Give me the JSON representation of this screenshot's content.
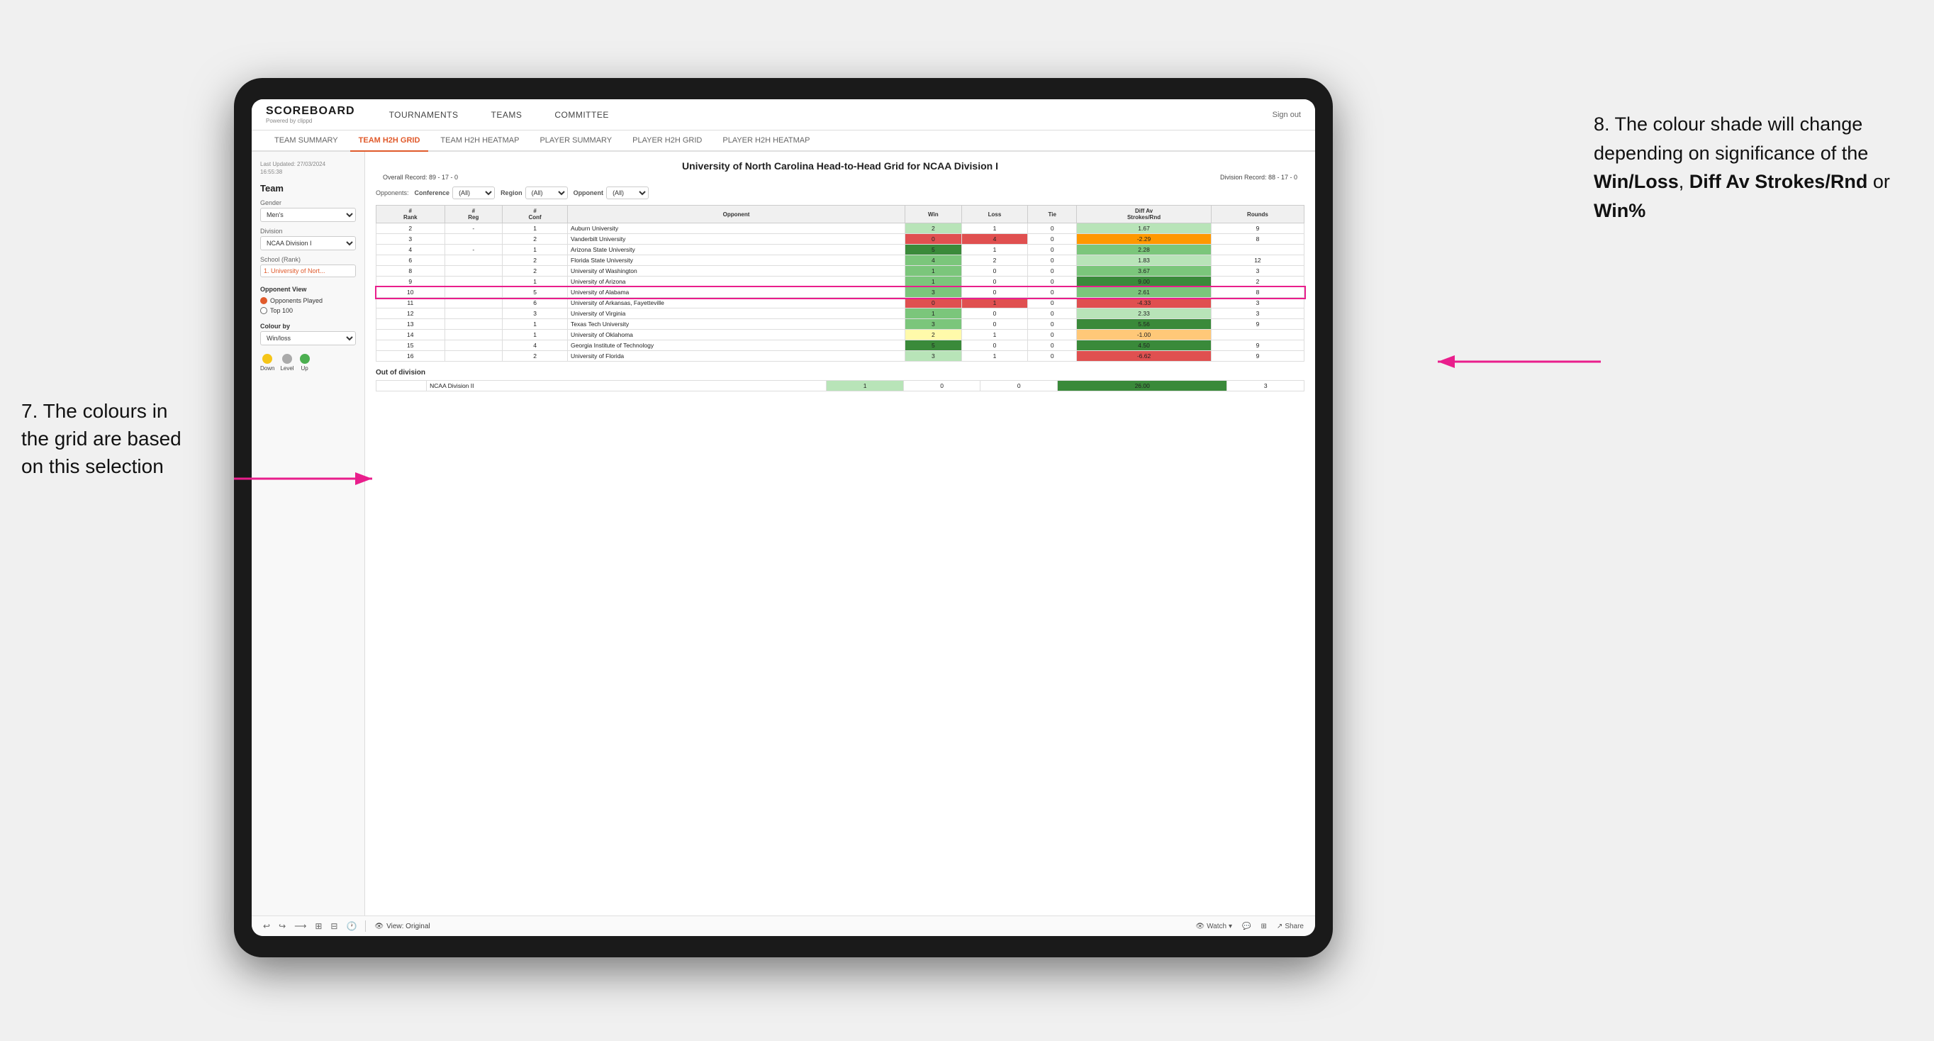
{
  "annotations": {
    "left_title": "8. The colour shade will change depending on significance of the",
    "left_bold1": "Win/Loss",
    "left_sep1": ", ",
    "left_bold2": "Diff Av Strokes/Rnd",
    "left_sep2": " or ",
    "left_bold3": "Win%",
    "annotation7_line1": "7. The colours in",
    "annotation7_line2": "the grid are based",
    "annotation7_line3": "on this selection"
  },
  "nav": {
    "logo": "SCOREBOARD",
    "logo_sub": "Powered by clippd",
    "items": [
      "TOURNAMENTS",
      "TEAMS",
      "COMMITTEE"
    ],
    "sign_out": "Sign out"
  },
  "sub_nav": {
    "items": [
      "TEAM SUMMARY",
      "TEAM H2H GRID",
      "TEAM H2H HEATMAP",
      "PLAYER SUMMARY",
      "PLAYER H2H GRID",
      "PLAYER H2H HEATMAP"
    ],
    "active": "TEAM H2H GRID"
  },
  "sidebar": {
    "last_updated_label": "Last Updated: 27/03/2024",
    "last_updated_time": "16:55:38",
    "team_title": "Team",
    "gender_label": "Gender",
    "gender_value": "Men's",
    "division_label": "Division",
    "division_value": "NCAA Division I",
    "school_label": "School (Rank)",
    "school_value": "1. University of Nort...",
    "opponent_view_title": "Opponent View",
    "radio_options": [
      "Opponents Played",
      "Top 100"
    ],
    "radio_selected": "Opponents Played",
    "colour_by_label": "Colour by",
    "colour_by_value": "Win/loss",
    "legend": [
      {
        "label": "Down",
        "color": "#f5c518"
      },
      {
        "label": "Level",
        "color": "#aaaaaa"
      },
      {
        "label": "Up",
        "color": "#4caf50"
      }
    ]
  },
  "grid": {
    "title": "University of North Carolina Head-to-Head Grid for NCAA Division I",
    "overall_record": "Overall Record: 89 - 17 - 0",
    "division_record": "Division Record: 88 - 17 - 0",
    "filters": {
      "opponents_label": "Opponents:",
      "conference_label": "Conference",
      "conference_value": "(All)",
      "region_label": "Region",
      "region_value": "(All)",
      "opponent_label": "Opponent",
      "opponent_value": "(All)"
    },
    "columns": [
      "#\nRank",
      "#\nReg",
      "#\nConf",
      "Opponent",
      "Win",
      "Loss",
      "Tie",
      "Diff Av\nStrokes/Rnd",
      "Rounds"
    ],
    "rows": [
      {
        "rank": "2",
        "reg": "-",
        "conf": "1",
        "opponent": "Auburn University",
        "win": "2",
        "loss": "1",
        "tie": "0",
        "diff": "1.67",
        "rounds": "9",
        "win_color": "green-light",
        "diff_color": "green-light"
      },
      {
        "rank": "3",
        "reg": "",
        "conf": "2",
        "opponent": "Vanderbilt University",
        "win": "0",
        "loss": "4",
        "tie": "0",
        "diff": "-2.29",
        "rounds": "8",
        "win_color": "red",
        "diff_color": "orange"
      },
      {
        "rank": "4",
        "reg": "-",
        "conf": "1",
        "opponent": "Arizona State University",
        "win": "5",
        "loss": "1",
        "tie": "0",
        "diff": "2.28",
        "rounds": "",
        "win_color": "green-dark",
        "diff_color": "green-mid"
      },
      {
        "rank": "6",
        "reg": "",
        "conf": "2",
        "opponent": "Florida State University",
        "win": "4",
        "loss": "2",
        "tie": "0",
        "diff": "1.83",
        "rounds": "12",
        "win_color": "green-mid",
        "diff_color": "green-light"
      },
      {
        "rank": "8",
        "reg": "",
        "conf": "2",
        "opponent": "University of Washington",
        "win": "1",
        "loss": "0",
        "tie": "0",
        "diff": "3.67",
        "rounds": "3",
        "win_color": "green-mid",
        "diff_color": "green-mid"
      },
      {
        "rank": "9",
        "reg": "",
        "conf": "1",
        "opponent": "University of Arizona",
        "win": "1",
        "loss": "0",
        "tie": "0",
        "diff": "9.00",
        "rounds": "2",
        "win_color": "green-mid",
        "diff_color": "green-dark"
      },
      {
        "rank": "10",
        "reg": "",
        "conf": "5",
        "opponent": "University of Alabama",
        "win": "3",
        "loss": "0",
        "tie": "0",
        "diff": "2.61",
        "rounds": "8",
        "win_color": "green-mid",
        "diff_color": "green-mid",
        "highlight": true
      },
      {
        "rank": "11",
        "reg": "",
        "conf": "6",
        "opponent": "University of Arkansas, Fayetteville",
        "win": "0",
        "loss": "1",
        "tie": "0",
        "diff": "-4.33",
        "rounds": "3",
        "win_color": "red",
        "diff_color": "red"
      },
      {
        "rank": "12",
        "reg": "",
        "conf": "3",
        "opponent": "University of Virginia",
        "win": "1",
        "loss": "0",
        "tie": "0",
        "diff": "2.33",
        "rounds": "3",
        "win_color": "green-mid",
        "diff_color": "green-light"
      },
      {
        "rank": "13",
        "reg": "",
        "conf": "1",
        "opponent": "Texas Tech University",
        "win": "3",
        "loss": "0",
        "tie": "0",
        "diff": "5.56",
        "rounds": "9",
        "win_color": "green-mid",
        "diff_color": "green-dark"
      },
      {
        "rank": "14",
        "reg": "",
        "conf": "1",
        "opponent": "University of Oklahoma",
        "win": "2",
        "loss": "1",
        "tie": "0",
        "diff": "-1.00",
        "rounds": "",
        "win_color": "yellow",
        "diff_color": "orange-light"
      },
      {
        "rank": "15",
        "reg": "",
        "conf": "4",
        "opponent": "Georgia Institute of Technology",
        "win": "5",
        "loss": "0",
        "tie": "0",
        "diff": "4.50",
        "rounds": "9",
        "win_color": "green-dark",
        "diff_color": "green-dark"
      },
      {
        "rank": "16",
        "reg": "",
        "conf": "2",
        "opponent": "University of Florida",
        "win": "3",
        "loss": "1",
        "tie": "0",
        "diff": "-6.62",
        "rounds": "9",
        "win_color": "green-light",
        "diff_color": "red"
      }
    ],
    "out_of_division_title": "Out of division",
    "out_of_division_rows": [
      {
        "label": "NCAA Division II",
        "win": "1",
        "loss": "0",
        "tie": "0",
        "diff": "26.00",
        "rounds": "3",
        "diff_color": "green-dark"
      }
    ]
  },
  "toolbar": {
    "view_label": "View: Original",
    "watch_label": "Watch",
    "share_label": "Share"
  }
}
